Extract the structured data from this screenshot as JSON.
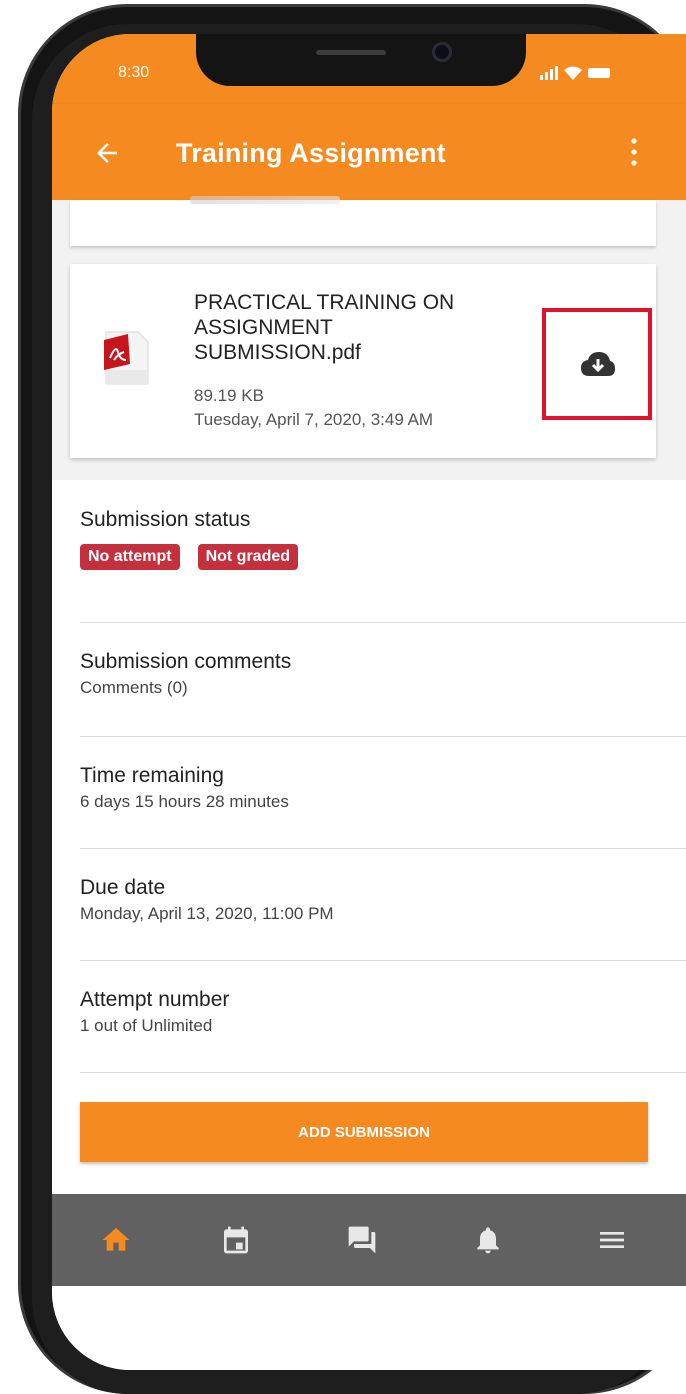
{
  "status_bar": {
    "time": "8:30"
  },
  "app_bar": {
    "title": "Training Assignment",
    "back_icon": "arrow-left-icon",
    "menu_icon": "more-vert-icon",
    "color": "#f58a20"
  },
  "file": {
    "icon": "pdf-file-icon",
    "name": "PRACTICAL TRAINING ON ASSIGNMENT SUBMISSION.pdf",
    "size": "89.19 KB",
    "date": "Tuesday, April 7, 2020, 3:49 AM",
    "download_icon": "cloud-download-icon",
    "highlight_color": "#e0112b"
  },
  "submission_status": {
    "title": "Submission status",
    "badges": [
      "No attempt",
      "Not graded"
    ],
    "badge_color": "#c5303f"
  },
  "submission_comments": {
    "title": "Submission comments",
    "value": "Comments (0)"
  },
  "time_remaining": {
    "title": "Time remaining",
    "value": "6 days 15 hours 28 minutes"
  },
  "due_date": {
    "title": "Due date",
    "value": "Monday, April 13, 2020, 11:00 PM"
  },
  "attempt_number": {
    "title": "Attempt number",
    "value": "1 out of Unlimited"
  },
  "add_submission": {
    "label": "ADD SUBMISSION"
  },
  "tab_bar": {
    "items": [
      {
        "icon": "home-icon",
        "active": true
      },
      {
        "icon": "calendar-icon",
        "active": false
      },
      {
        "icon": "messages-icon",
        "active": false
      },
      {
        "icon": "bell-icon",
        "active": false
      },
      {
        "icon": "menu-icon",
        "active": false
      }
    ],
    "active_color": "#f58a20",
    "inactive_color": "#e8e8e8"
  }
}
